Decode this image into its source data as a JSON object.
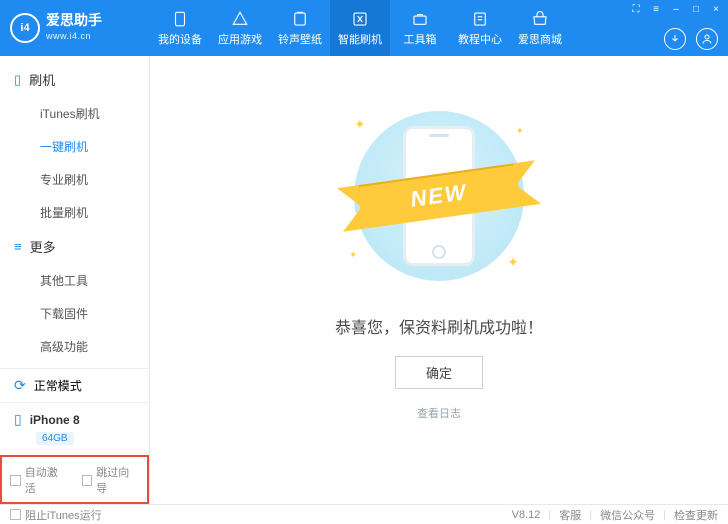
{
  "brand": {
    "name": "爱思助手",
    "url": "www.i4.cn",
    "logo_text": "i4"
  },
  "titlebar": {
    "cart": "⛶",
    "gear": "≡",
    "min": "–",
    "max": "□",
    "close": "×"
  },
  "nav": [
    {
      "label": "我的设备",
      "icon": "device"
    },
    {
      "label": "应用游戏",
      "icon": "apps"
    },
    {
      "label": "铃声壁纸",
      "icon": "ringtone"
    },
    {
      "label": "智能刷机",
      "icon": "flash",
      "active": true
    },
    {
      "label": "工具箱",
      "icon": "toolbox"
    },
    {
      "label": "教程中心",
      "icon": "tutorial"
    },
    {
      "label": "爱思商城",
      "icon": "store"
    }
  ],
  "sidebar": {
    "groups": [
      {
        "title": "刷机",
        "items": [
          "iTunes刷机",
          "一键刷机",
          "专业刷机",
          "批量刷机"
        ],
        "active_index": 1
      },
      {
        "title": "更多",
        "items": [
          "其他工具",
          "下载固件",
          "高级功能"
        ],
        "active_index": -1
      }
    ],
    "mode": "正常模式",
    "device": {
      "name": "iPhone 8",
      "storage": "64GB"
    },
    "options": {
      "auto_activate": "自动激活",
      "skip_wizard": "跳过向导"
    }
  },
  "main": {
    "ribbon_text": "NEW",
    "success": "恭喜您，保资料刷机成功啦！",
    "ok": "确定",
    "view_log": "查看日志"
  },
  "footer": {
    "block_itunes": "阻止iTunes运行",
    "version": "V8.12",
    "support": "客服",
    "wechat": "微信公众号",
    "update": "检查更新"
  }
}
